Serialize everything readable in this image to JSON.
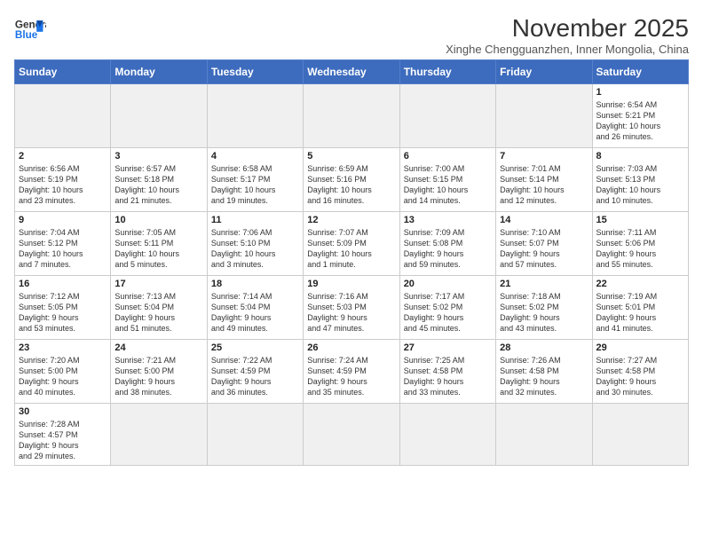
{
  "logo": {
    "line1": "General",
    "line2": "Blue"
  },
  "title": "November 2025",
  "subtitle": "Xinghe Chengguanzhen, Inner Mongolia, China",
  "days_of_week": [
    "Sunday",
    "Monday",
    "Tuesday",
    "Wednesday",
    "Thursday",
    "Friday",
    "Saturday"
  ],
  "weeks": [
    [
      {
        "day": "",
        "info": "",
        "empty": true
      },
      {
        "day": "",
        "info": "",
        "empty": true
      },
      {
        "day": "",
        "info": "",
        "empty": true
      },
      {
        "day": "",
        "info": "",
        "empty": true
      },
      {
        "day": "",
        "info": "",
        "empty": true
      },
      {
        "day": "",
        "info": "",
        "empty": true
      },
      {
        "day": "1",
        "info": "Sunrise: 6:54 AM\nSunset: 5:21 PM\nDaylight: 10 hours\nand 26 minutes."
      }
    ],
    [
      {
        "day": "2",
        "info": "Sunrise: 6:56 AM\nSunset: 5:19 PM\nDaylight: 10 hours\nand 23 minutes."
      },
      {
        "day": "3",
        "info": "Sunrise: 6:57 AM\nSunset: 5:18 PM\nDaylight: 10 hours\nand 21 minutes."
      },
      {
        "day": "4",
        "info": "Sunrise: 6:58 AM\nSunset: 5:17 PM\nDaylight: 10 hours\nand 19 minutes."
      },
      {
        "day": "5",
        "info": "Sunrise: 6:59 AM\nSunset: 5:16 PM\nDaylight: 10 hours\nand 16 minutes."
      },
      {
        "day": "6",
        "info": "Sunrise: 7:00 AM\nSunset: 5:15 PM\nDaylight: 10 hours\nand 14 minutes."
      },
      {
        "day": "7",
        "info": "Sunrise: 7:01 AM\nSunset: 5:14 PM\nDaylight: 10 hours\nand 12 minutes."
      },
      {
        "day": "8",
        "info": "Sunrise: 7:03 AM\nSunset: 5:13 PM\nDaylight: 10 hours\nand 10 minutes."
      }
    ],
    [
      {
        "day": "9",
        "info": "Sunrise: 7:04 AM\nSunset: 5:12 PM\nDaylight: 10 hours\nand 7 minutes."
      },
      {
        "day": "10",
        "info": "Sunrise: 7:05 AM\nSunset: 5:11 PM\nDaylight: 10 hours\nand 5 minutes."
      },
      {
        "day": "11",
        "info": "Sunrise: 7:06 AM\nSunset: 5:10 PM\nDaylight: 10 hours\nand 3 minutes."
      },
      {
        "day": "12",
        "info": "Sunrise: 7:07 AM\nSunset: 5:09 PM\nDaylight: 10 hours\nand 1 minute."
      },
      {
        "day": "13",
        "info": "Sunrise: 7:09 AM\nSunset: 5:08 PM\nDaylight: 9 hours\nand 59 minutes."
      },
      {
        "day": "14",
        "info": "Sunrise: 7:10 AM\nSunset: 5:07 PM\nDaylight: 9 hours\nand 57 minutes."
      },
      {
        "day": "15",
        "info": "Sunrise: 7:11 AM\nSunset: 5:06 PM\nDaylight: 9 hours\nand 55 minutes."
      }
    ],
    [
      {
        "day": "16",
        "info": "Sunrise: 7:12 AM\nSunset: 5:05 PM\nDaylight: 9 hours\nand 53 minutes."
      },
      {
        "day": "17",
        "info": "Sunrise: 7:13 AM\nSunset: 5:04 PM\nDaylight: 9 hours\nand 51 minutes."
      },
      {
        "day": "18",
        "info": "Sunrise: 7:14 AM\nSunset: 5:04 PM\nDaylight: 9 hours\nand 49 minutes."
      },
      {
        "day": "19",
        "info": "Sunrise: 7:16 AM\nSunset: 5:03 PM\nDaylight: 9 hours\nand 47 minutes."
      },
      {
        "day": "20",
        "info": "Sunrise: 7:17 AM\nSunset: 5:02 PM\nDaylight: 9 hours\nand 45 minutes."
      },
      {
        "day": "21",
        "info": "Sunrise: 7:18 AM\nSunset: 5:02 PM\nDaylight: 9 hours\nand 43 minutes."
      },
      {
        "day": "22",
        "info": "Sunrise: 7:19 AM\nSunset: 5:01 PM\nDaylight: 9 hours\nand 41 minutes."
      }
    ],
    [
      {
        "day": "23",
        "info": "Sunrise: 7:20 AM\nSunset: 5:00 PM\nDaylight: 9 hours\nand 40 minutes."
      },
      {
        "day": "24",
        "info": "Sunrise: 7:21 AM\nSunset: 5:00 PM\nDaylight: 9 hours\nand 38 minutes."
      },
      {
        "day": "25",
        "info": "Sunrise: 7:22 AM\nSunset: 4:59 PM\nDaylight: 9 hours\nand 36 minutes."
      },
      {
        "day": "26",
        "info": "Sunrise: 7:24 AM\nSunset: 4:59 PM\nDaylight: 9 hours\nand 35 minutes."
      },
      {
        "day": "27",
        "info": "Sunrise: 7:25 AM\nSunset: 4:58 PM\nDaylight: 9 hours\nand 33 minutes."
      },
      {
        "day": "28",
        "info": "Sunrise: 7:26 AM\nSunset: 4:58 PM\nDaylight: 9 hours\nand 32 minutes."
      },
      {
        "day": "29",
        "info": "Sunrise: 7:27 AM\nSunset: 4:58 PM\nDaylight: 9 hours\nand 30 minutes."
      }
    ],
    [
      {
        "day": "30",
        "info": "Sunrise: 7:28 AM\nSunset: 4:57 PM\nDaylight: 9 hours\nand 29 minutes."
      },
      {
        "day": "",
        "info": "",
        "empty": true
      },
      {
        "day": "",
        "info": "",
        "empty": true
      },
      {
        "day": "",
        "info": "",
        "empty": true
      },
      {
        "day": "",
        "info": "",
        "empty": true
      },
      {
        "day": "",
        "info": "",
        "empty": true
      },
      {
        "day": "",
        "info": "",
        "empty": true
      }
    ]
  ]
}
